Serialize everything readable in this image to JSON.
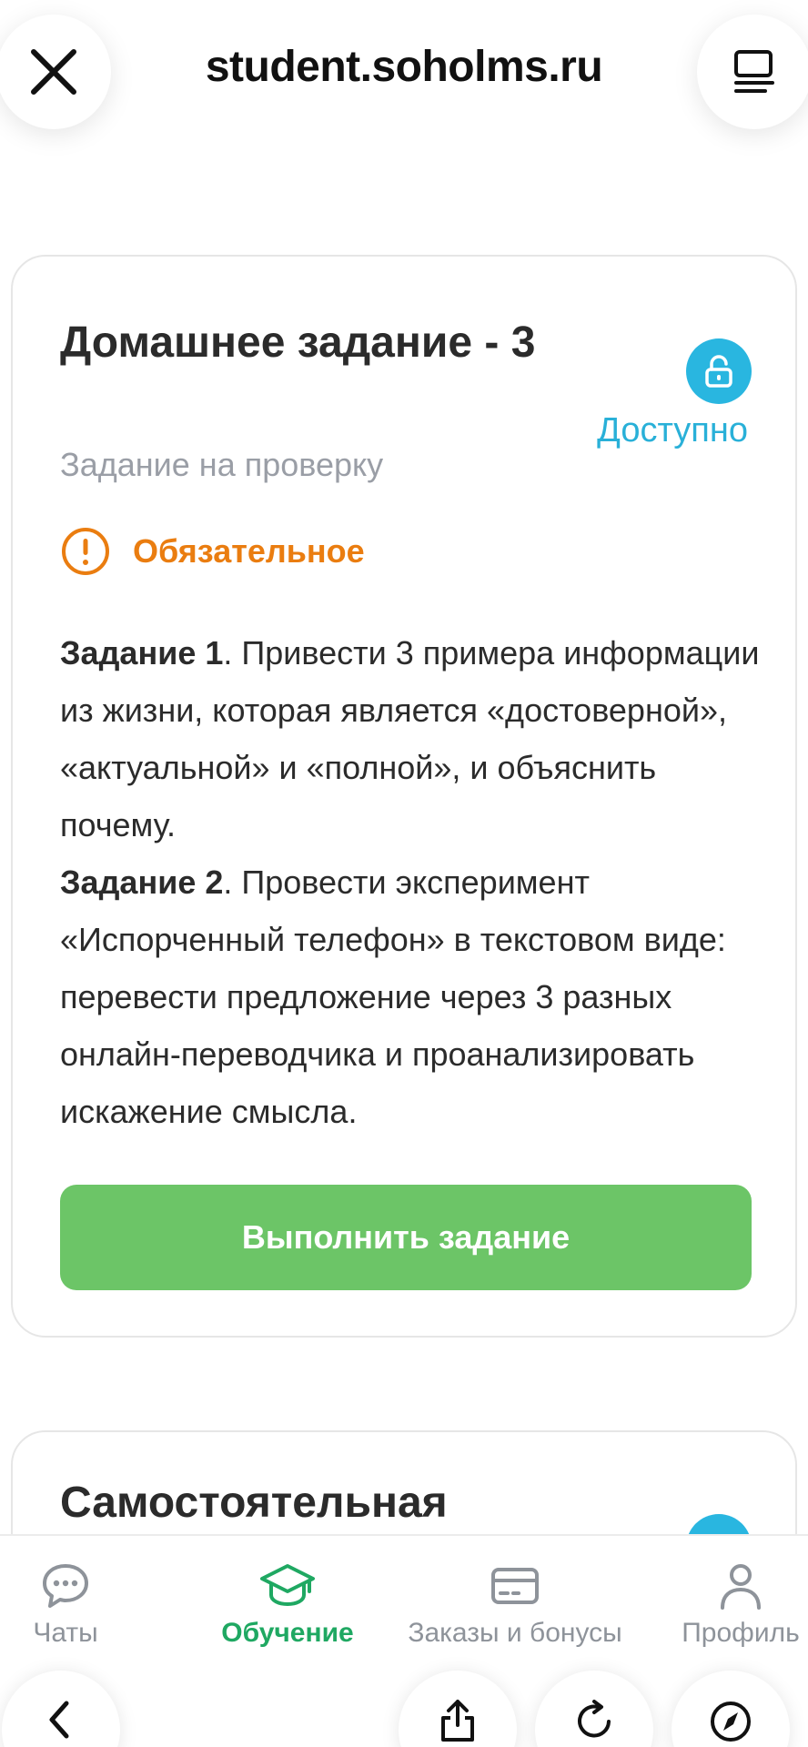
{
  "browser": {
    "url": "student.soholms.ru"
  },
  "task": {
    "title": "Домашнее задание - 3",
    "type": "Задание на проверку",
    "status": "Доступно",
    "required_label": "Обязательное",
    "items": [
      {
        "label": "Задание 1",
        "text": ". Привести 3 примера информации из жизни, которая является «достоверной», «актуальной» и «полной», и объяснить почему."
      },
      {
        "label": "Задание 2",
        "text": ". Провести эксперимент «Испорченный телефон» в текстовом виде: перевести предложение через 3 разных онлайн-переводчика и проанализировать искажение смысла."
      }
    ],
    "action_label": "Выполнить задание"
  },
  "next_task": {
    "title": "Самостоятельная"
  },
  "tabbar": {
    "items": [
      {
        "label": "Чаты",
        "icon": "chat-icon",
        "active": false
      },
      {
        "label": "Обучение",
        "icon": "graduation-cap-icon",
        "active": true
      },
      {
        "label": "Заказы и бонусы",
        "icon": "card-icon",
        "active": false
      },
      {
        "label": "Профиль",
        "icon": "profile-icon",
        "active": false
      }
    ]
  },
  "colors": {
    "accent_blue": "#29b6e0",
    "required_orange": "#ea7d10",
    "cta_green": "#6cc567",
    "active_tab_green": "#1fa862"
  }
}
